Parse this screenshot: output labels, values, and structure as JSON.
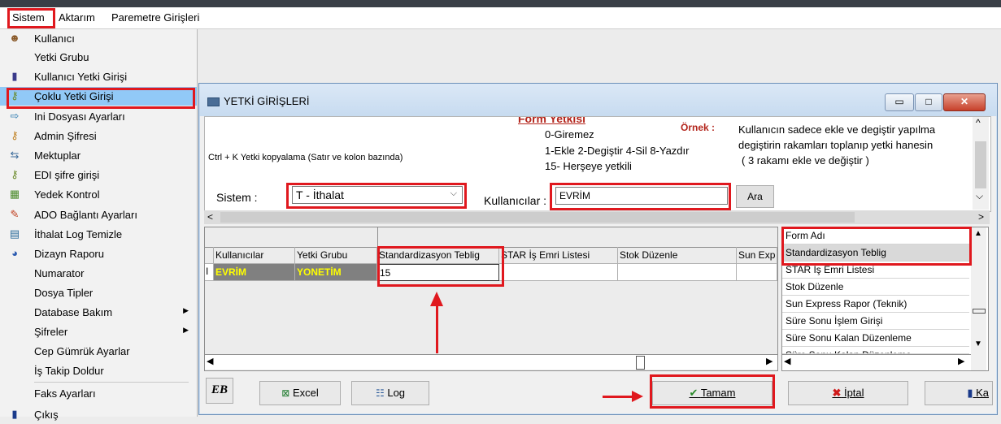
{
  "menubar": {
    "items": [
      "Sistem",
      "Aktarım",
      "Paremetre Girişleri"
    ]
  },
  "sistem_menu": {
    "items": [
      {
        "label": "Kullanıcı",
        "icon": "user-icon",
        "glyph": "☻"
      },
      {
        "label": "Yetki Grubu",
        "icon": "",
        "glyph": ""
      },
      {
        "label": "Kullanıcı Yetki Girişi",
        "icon": "bottle-icon",
        "glyph": "▮"
      },
      {
        "label": "Çoklu Yetki Girişi",
        "icon": "key-icon",
        "glyph": "⚷"
      },
      {
        "label": "Ini Dosyası  Ayarları",
        "icon": "file-arrow-icon",
        "glyph": "⇨"
      },
      {
        "label": "Admin Şifresi",
        "icon": "key-icon",
        "glyph": "⚷"
      },
      {
        "label": "Mektuplar",
        "icon": "arrows-icon",
        "glyph": "⇆"
      },
      {
        "label": "EDI şifre girişi",
        "icon": "key-icon",
        "glyph": "⚷"
      },
      {
        "label": "Yedek Kontrol",
        "icon": "backup-icon",
        "glyph": "▦"
      },
      {
        "label": "ADO Bağlantı Ayarları",
        "icon": "plug-icon",
        "glyph": "✎"
      },
      {
        "label": "İthalat Log Temizle",
        "icon": "log-icon",
        "glyph": "▤"
      },
      {
        "label": "Dizayn Raporu",
        "icon": "report-icon",
        "glyph": "◕"
      },
      {
        "label": "Numarator",
        "icon": "",
        "glyph": ""
      },
      {
        "label": "Dosya Tipler",
        "icon": "",
        "glyph": ""
      },
      {
        "label": "Database Bakım",
        "icon": "",
        "glyph": "",
        "submenu": "▶"
      },
      {
        "label": "Şifreler",
        "icon": "",
        "glyph": "",
        "submenu": "▶"
      },
      {
        "label": "Cep Gümrük Ayarlar",
        "icon": "",
        "glyph": ""
      },
      {
        "label": "İş Takip Doldur",
        "icon": "",
        "glyph": ""
      },
      {
        "label": "Faks Ayarları",
        "icon": "",
        "glyph": ""
      },
      {
        "label": "Çıkış",
        "icon": "exit-icon",
        "glyph": "▮"
      }
    ]
  },
  "window": {
    "title": "YETKİ GİRİŞLERİ",
    "controls": {
      "minimize": "▭",
      "maximize": "□",
      "close": "✕"
    }
  },
  "info": {
    "copy_hint": "Ctrl + K Yetki kopyalama (Satır ve kolon bazında)",
    "form_yetkisi": "Form Yetkisi",
    "codes": [
      "0-Giremez",
      "1-Ekle  2-Degiştir  4-Sil  8-Yazdır",
      "15- Herşeye yetkili"
    ],
    "ornek_label": "Örnek :",
    "ornek_text": [
      "Kullanıcın sadece ekle ve degiştir yapılma",
      "degiştirin rakamları toplanıp yetki hanesin",
      "( 3 rakamı ekle ve değiştir )"
    ]
  },
  "filters": {
    "sistem_label": "Sistem :",
    "sistem_value": "T - İthalat",
    "kullanicilar_label": "Kullanıcılar :",
    "kullanicilar_value": "EVRİM",
    "ara_button": "Ara"
  },
  "grid": {
    "columns": [
      "Kullanıcılar",
      "Yetki Grubu",
      "Standardizasyon Teblig",
      "STAR İş Emri Listesi",
      "Stok Düzenle",
      "Sun Exp"
    ],
    "rows": [
      {
        "marker": "I",
        "user": "EVRİM",
        "group": "YONETİM",
        "standardizasyon": "15"
      }
    ]
  },
  "form_list": {
    "header": "Form Adı",
    "items": [
      "Standardizasyon Teblig",
      "STAR İş Emri Listesi",
      "Stok Düzenle",
      "Sun Express Rapor (Teknik)",
      "Süre Sonu İşlem Girişi",
      "Süre Sonu Kalan Düzenleme",
      "Süre Sonu Kalan Düzenleme"
    ]
  },
  "buttons": {
    "eb_logo": "EB",
    "excel": "Excel",
    "log": "Log",
    "tamam": "Tamam",
    "iptal": "İptal",
    "kapat": "Ka"
  },
  "colors": {
    "highlight": "#e0181e",
    "selection": "#91c9f7",
    "user_cell_bg": "#808080",
    "user_cell_fg": "#ffff00"
  }
}
